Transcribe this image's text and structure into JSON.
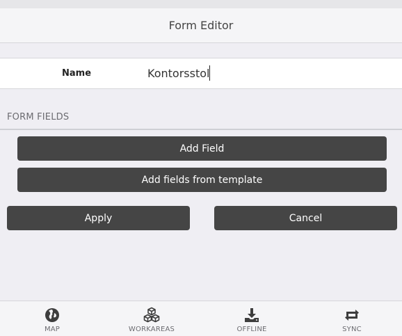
{
  "header": {
    "title": "Form Editor"
  },
  "form": {
    "name_label": "Name",
    "name_value": "Kontorsstol"
  },
  "section": {
    "fields_label": "FORM FIELDS"
  },
  "buttons": {
    "add_field": "Add Field",
    "add_from_template": "Add fields from template",
    "apply": "Apply",
    "cancel": "Cancel"
  },
  "tabs": [
    {
      "label": "MAP",
      "icon": "globe-icon"
    },
    {
      "label": "WORKAREAS",
      "icon": "boxes-icon"
    },
    {
      "label": "OFFLINE",
      "icon": "download-icon"
    },
    {
      "label": "SYNC",
      "icon": "sync-icon"
    }
  ],
  "colors": {
    "button_bg": "#454545",
    "background": "#efeef3",
    "icon": "#3d3d3d"
  }
}
